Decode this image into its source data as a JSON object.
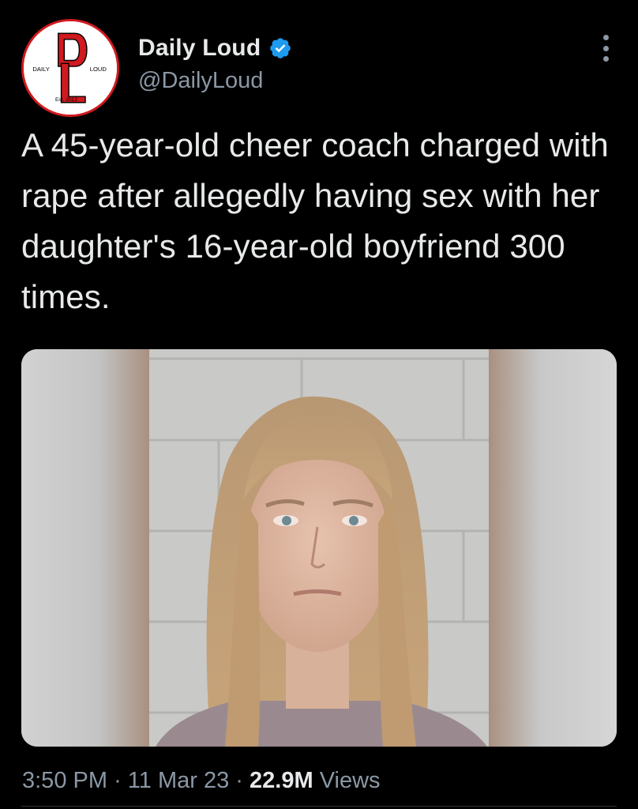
{
  "account": {
    "display_name": "Daily Loud",
    "handle": "@DailyLoud",
    "verified": true,
    "avatar_logo": {
      "left_text": "DAILY",
      "right_text": "LOUD",
      "bottom_text": "Est. 2012",
      "brand_color": "#d11a1f"
    }
  },
  "tweet": {
    "text": "A 45-year-old cheer coach charged with rape after allegedly having sex with her daughter's 16-year-old boyfriend 300 times.",
    "media_alt": "mugshot-photo"
  },
  "meta": {
    "time": "3:50 PM",
    "separator": "·",
    "date": "11 Mar 23",
    "views_count": "22.9M",
    "views_label": "Views"
  },
  "colors": {
    "background": "#000000",
    "primary_text": "#e7e9ea",
    "secondary_text": "#8b98a5",
    "verified_blue": "#1d9bf0"
  },
  "icons": {
    "verified": "verified-badge-icon",
    "more": "more-options-icon"
  }
}
